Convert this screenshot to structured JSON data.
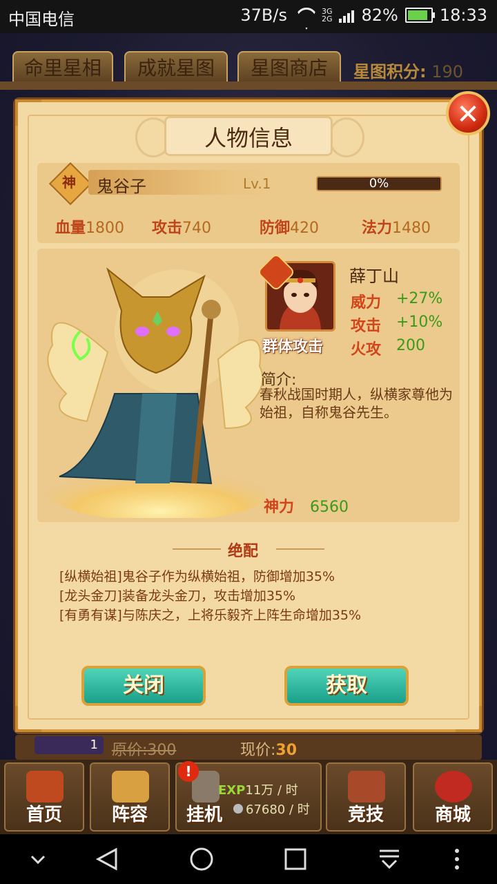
{
  "status": {
    "carrier": "中国电信",
    "speed": "37B/s",
    "net_top": "3G",
    "net_bottom": "2G",
    "battery": "82%",
    "time": "18:33"
  },
  "tabs": [
    {
      "label": "命里星相"
    },
    {
      "label": "成就星图"
    },
    {
      "label": "星图商店"
    }
  ],
  "score": {
    "label": "星图积分:",
    "value": "190"
  },
  "dialog": {
    "title": "人物信息",
    "close_symbol": "✕",
    "god_badge": "神",
    "name": "鬼谷子",
    "level": "Lv.1",
    "exp_percent_text": "0%",
    "exp_fraction": 0,
    "stats": [
      {
        "label": "血量",
        "value": "1800"
      },
      {
        "label": "攻击",
        "value": "740"
      },
      {
        "label": "防御",
        "value": "420"
      },
      {
        "label": "法力",
        "value": "1480"
      }
    ],
    "partner": {
      "name": "薛丁山",
      "skill_tag": "群体攻击",
      "buffs": [
        {
          "label": "威力",
          "value": "+27%"
        },
        {
          "label": "攻击",
          "value": "+10%"
        },
        {
          "label": "火攻",
          "value": "200"
        }
      ]
    },
    "intro_title": "简介:",
    "intro_body": "春秋战国时期人，纵横家尊他为始祖，自称鬼谷先生。",
    "power_label": "神力",
    "power_value": "6560",
    "combo_title": "绝配",
    "combos": [
      "[纵横始祖]鬼谷子作为纵横始祖，防御增加35%",
      "[龙头金刀]装备龙头金刀，攻击增加35%",
      "[有勇有谋]与陈庆之，上将乐毅齐上阵生命增加35%"
    ],
    "close_button": "关闭",
    "get_button": "获取"
  },
  "pricebar": {
    "count": "1",
    "orig_label": "原价:",
    "orig_value": "300",
    "now_label": "现价:",
    "now_value": "30"
  },
  "nav": [
    {
      "label": "首页"
    },
    {
      "label": "阵容"
    },
    {
      "label": "挂机"
    },
    {
      "label": "竞技"
    },
    {
      "label": "商城"
    }
  ],
  "idle": {
    "exp_label": "EXP",
    "exp_value": "11万 / 时",
    "coin_value": "67680 / 时",
    "badge": "!"
  },
  "colors": {
    "accent_gold": "#d89a3a",
    "button_teal": "#1aa08a",
    "buff_green": "#3a9a1a",
    "stat_red": "#c0441a"
  }
}
